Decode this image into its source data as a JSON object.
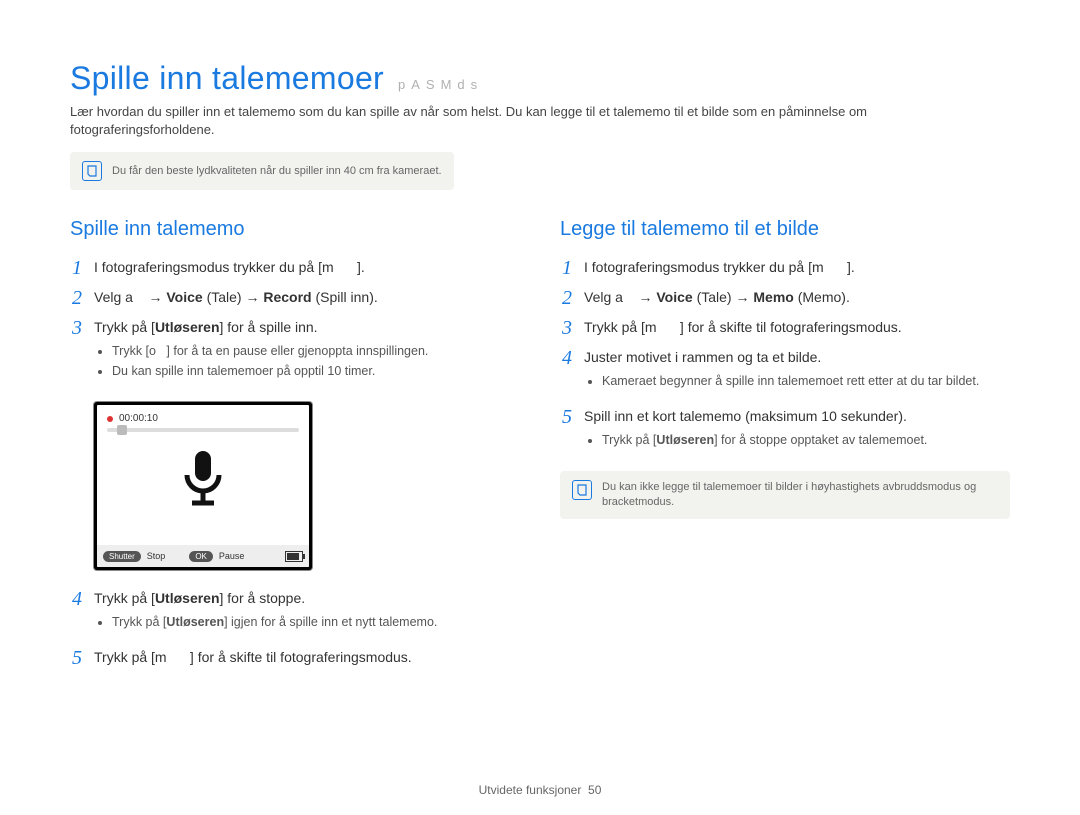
{
  "header": {
    "title": "Spille inn talememoer",
    "modes": "pASMds",
    "intro": "Lær hvordan du spiller inn et talememo som du kan spille av når som helst. Du kan legge til et talememo til et bilde som en påminnelse om fotograferingsforholdene.",
    "tip": "Du får den beste lydkvaliteten når du spiller inn 40 cm fra kameraet."
  },
  "left": {
    "heading": "Spille inn talememo",
    "step1": "I fotograferingsmodus trykker du på [m      ].",
    "step2_pre": "Velg a    → ",
    "step2_voice": "Voice",
    "step2_voice_sub": " (Tale) → ",
    "step2_record": "Record",
    "step2_record_sub": " (Spill inn).",
    "step3_pre": "Trykk på [",
    "step3_btn": "Utløseren",
    "step3_post": "] for å spille inn.",
    "step3_b1_pre": "Trykk [o   ] for å ta en pause eller gjenoppta innspillingen.",
    "step3_b2": "Du kan spille inn talememoer på opptil 10 timer.",
    "device": {
      "timer": "00:00:10",
      "stop_label": "Stop",
      "pause_label": "Pause",
      "shutter_pill": "Shutter",
      "ok_pill": "OK"
    },
    "step4_pre": "Trykk på [",
    "step4_btn": "Utløseren",
    "step4_post": "] for å stoppe.",
    "step4_b1_pre": "Trykk på [",
    "step4_b1_btn": "Utløseren",
    "step4_b1_post": "] igjen for å spille inn et nytt talememo.",
    "step5": "Trykk på [m      ] for å skifte til fotograferingsmodus."
  },
  "right": {
    "heading": "Legge til talememo til et bilde",
    "step1": "I fotograferingsmodus trykker du på [m      ].",
    "step2_pre": "Velg a    → ",
    "step2_voice": "Voice",
    "step2_voice_sub": " (Tale) → ",
    "step2_memo": "Memo",
    "step2_memo_sub": " (Memo).",
    "step3": "Trykk på [m      ] for å skifte til fotograferingsmodus.",
    "step4": "Juster motivet i rammen og ta et bilde.",
    "step4_b1": "Kameraet begynner å spille inn talememoet rett etter at du tar bildet.",
    "step5": "Spill inn et kort talememo (maksimum 10 sekunder).",
    "step5_b1_pre": "Trykk på [",
    "step5_b1_btn": "Utløseren",
    "step5_b1_post": "] for å stoppe opptaket av talememoet.",
    "tip": "Du kan ikke legge til talememoer til bilder i høyhastighets avbruddsmodus og bracketmodus."
  },
  "footer": {
    "section": "Utvidete funksjoner",
    "page": "50"
  }
}
